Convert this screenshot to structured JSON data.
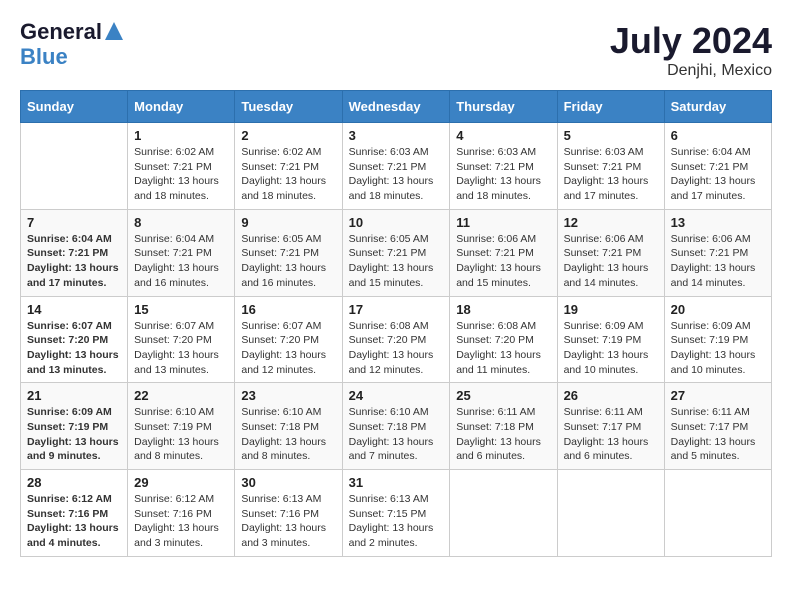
{
  "header": {
    "logo_line1": "General",
    "logo_line2": "Blue",
    "month": "July 2024",
    "location": "Denjhi, Mexico"
  },
  "days_of_week": [
    "Sunday",
    "Monday",
    "Tuesday",
    "Wednesday",
    "Thursday",
    "Friday",
    "Saturday"
  ],
  "weeks": [
    [
      {
        "day": "",
        "sunrise": "",
        "sunset": "",
        "daylight": ""
      },
      {
        "day": "1",
        "sunrise": "Sunrise: 6:02 AM",
        "sunset": "Sunset: 7:21 PM",
        "daylight": "Daylight: 13 hours and 18 minutes."
      },
      {
        "day": "2",
        "sunrise": "Sunrise: 6:02 AM",
        "sunset": "Sunset: 7:21 PM",
        "daylight": "Daylight: 13 hours and 18 minutes."
      },
      {
        "day": "3",
        "sunrise": "Sunrise: 6:03 AM",
        "sunset": "Sunset: 7:21 PM",
        "daylight": "Daylight: 13 hours and 18 minutes."
      },
      {
        "day": "4",
        "sunrise": "Sunrise: 6:03 AM",
        "sunset": "Sunset: 7:21 PM",
        "daylight": "Daylight: 13 hours and 18 minutes."
      },
      {
        "day": "5",
        "sunrise": "Sunrise: 6:03 AM",
        "sunset": "Sunset: 7:21 PM",
        "daylight": "Daylight: 13 hours and 17 minutes."
      },
      {
        "day": "6",
        "sunrise": "Sunrise: 6:04 AM",
        "sunset": "Sunset: 7:21 PM",
        "daylight": "Daylight: 13 hours and 17 minutes."
      }
    ],
    [
      {
        "day": "7",
        "sunrise": "Sunrise: 6:04 AM",
        "sunset": "Sunset: 7:21 PM",
        "daylight": "Daylight: 13 hours and 17 minutes."
      },
      {
        "day": "8",
        "sunrise": "Sunrise: 6:04 AM",
        "sunset": "Sunset: 7:21 PM",
        "daylight": "Daylight: 13 hours and 16 minutes."
      },
      {
        "day": "9",
        "sunrise": "Sunrise: 6:05 AM",
        "sunset": "Sunset: 7:21 PM",
        "daylight": "Daylight: 13 hours and 16 minutes."
      },
      {
        "day": "10",
        "sunrise": "Sunrise: 6:05 AM",
        "sunset": "Sunset: 7:21 PM",
        "daylight": "Daylight: 13 hours and 15 minutes."
      },
      {
        "day": "11",
        "sunrise": "Sunrise: 6:06 AM",
        "sunset": "Sunset: 7:21 PM",
        "daylight": "Daylight: 13 hours and 15 minutes."
      },
      {
        "day": "12",
        "sunrise": "Sunrise: 6:06 AM",
        "sunset": "Sunset: 7:21 PM",
        "daylight": "Daylight: 13 hours and 14 minutes."
      },
      {
        "day": "13",
        "sunrise": "Sunrise: 6:06 AM",
        "sunset": "Sunset: 7:21 PM",
        "daylight": "Daylight: 13 hours and 14 minutes."
      }
    ],
    [
      {
        "day": "14",
        "sunrise": "Sunrise: 6:07 AM",
        "sunset": "Sunset: 7:20 PM",
        "daylight": "Daylight: 13 hours and 13 minutes."
      },
      {
        "day": "15",
        "sunrise": "Sunrise: 6:07 AM",
        "sunset": "Sunset: 7:20 PM",
        "daylight": "Daylight: 13 hours and 13 minutes."
      },
      {
        "day": "16",
        "sunrise": "Sunrise: 6:07 AM",
        "sunset": "Sunset: 7:20 PM",
        "daylight": "Daylight: 13 hours and 12 minutes."
      },
      {
        "day": "17",
        "sunrise": "Sunrise: 6:08 AM",
        "sunset": "Sunset: 7:20 PM",
        "daylight": "Daylight: 13 hours and 12 minutes."
      },
      {
        "day": "18",
        "sunrise": "Sunrise: 6:08 AM",
        "sunset": "Sunset: 7:20 PM",
        "daylight": "Daylight: 13 hours and 11 minutes."
      },
      {
        "day": "19",
        "sunrise": "Sunrise: 6:09 AM",
        "sunset": "Sunset: 7:19 PM",
        "daylight": "Daylight: 13 hours and 10 minutes."
      },
      {
        "day": "20",
        "sunrise": "Sunrise: 6:09 AM",
        "sunset": "Sunset: 7:19 PM",
        "daylight": "Daylight: 13 hours and 10 minutes."
      }
    ],
    [
      {
        "day": "21",
        "sunrise": "Sunrise: 6:09 AM",
        "sunset": "Sunset: 7:19 PM",
        "daylight": "Daylight: 13 hours and 9 minutes."
      },
      {
        "day": "22",
        "sunrise": "Sunrise: 6:10 AM",
        "sunset": "Sunset: 7:19 PM",
        "daylight": "Daylight: 13 hours and 8 minutes."
      },
      {
        "day": "23",
        "sunrise": "Sunrise: 6:10 AM",
        "sunset": "Sunset: 7:18 PM",
        "daylight": "Daylight: 13 hours and 8 minutes."
      },
      {
        "day": "24",
        "sunrise": "Sunrise: 6:10 AM",
        "sunset": "Sunset: 7:18 PM",
        "daylight": "Daylight: 13 hours and 7 minutes."
      },
      {
        "day": "25",
        "sunrise": "Sunrise: 6:11 AM",
        "sunset": "Sunset: 7:18 PM",
        "daylight": "Daylight: 13 hours and 6 minutes."
      },
      {
        "day": "26",
        "sunrise": "Sunrise: 6:11 AM",
        "sunset": "Sunset: 7:17 PM",
        "daylight": "Daylight: 13 hours and 6 minutes."
      },
      {
        "day": "27",
        "sunrise": "Sunrise: 6:11 AM",
        "sunset": "Sunset: 7:17 PM",
        "daylight": "Daylight: 13 hours and 5 minutes."
      }
    ],
    [
      {
        "day": "28",
        "sunrise": "Sunrise: 6:12 AM",
        "sunset": "Sunset: 7:16 PM",
        "daylight": "Daylight: 13 hours and 4 minutes."
      },
      {
        "day": "29",
        "sunrise": "Sunrise: 6:12 AM",
        "sunset": "Sunset: 7:16 PM",
        "daylight": "Daylight: 13 hours and 3 minutes."
      },
      {
        "day": "30",
        "sunrise": "Sunrise: 6:13 AM",
        "sunset": "Sunset: 7:16 PM",
        "daylight": "Daylight: 13 hours and 3 minutes."
      },
      {
        "day": "31",
        "sunrise": "Sunrise: 6:13 AM",
        "sunset": "Sunset: 7:15 PM",
        "daylight": "Daylight: 13 hours and 2 minutes."
      },
      {
        "day": "",
        "sunrise": "",
        "sunset": "",
        "daylight": ""
      },
      {
        "day": "",
        "sunrise": "",
        "sunset": "",
        "daylight": ""
      },
      {
        "day": "",
        "sunrise": "",
        "sunset": "",
        "daylight": ""
      }
    ]
  ]
}
